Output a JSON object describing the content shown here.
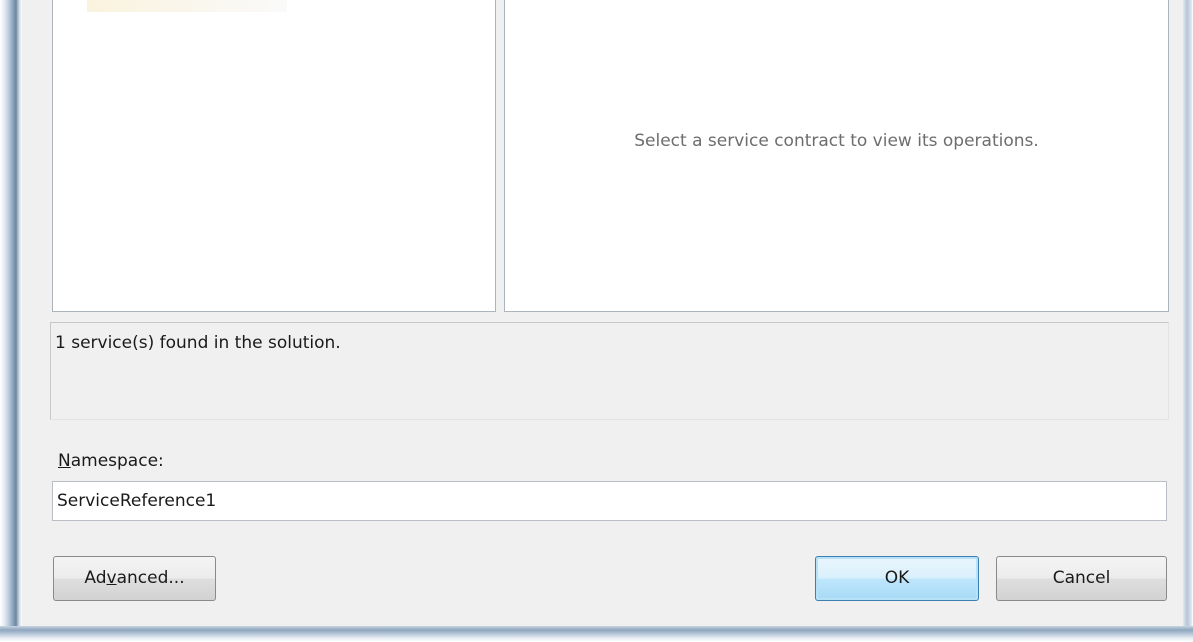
{
  "operations_placeholder": "Select a service contract to view its operations.",
  "status": {
    "text": "1 service(s) found in the solution."
  },
  "namespace": {
    "label_hotkey": "N",
    "label_rest": "amespace:",
    "value": "ServiceReference1"
  },
  "buttons": {
    "advanced_before": "Ad",
    "advanced_hotkey": "v",
    "advanced_after": "anced...",
    "ok": "OK",
    "cancel": "Cancel"
  },
  "colors": {
    "dialog_background": "#f0f0f0",
    "default_button_border": "#3c7fb1"
  }
}
